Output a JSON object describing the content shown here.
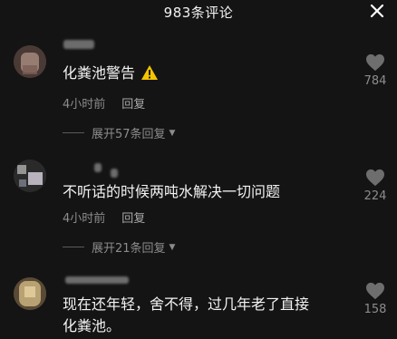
{
  "header": {
    "title": "983条评论",
    "close_icon": "close-icon"
  },
  "comments": [
    {
      "text": "化粪池警告",
      "has_warning_icon": true,
      "time": "4小时前",
      "reply_label": "回复",
      "expand_label": "展开57条回复",
      "likes": "784"
    },
    {
      "text": "不听话的时候两吨水解决一切问题",
      "time": "4小时前",
      "reply_label": "回复",
      "expand_label": "展开21条回复",
      "likes": "224"
    },
    {
      "text_line1": "现在还年轻，舍不得，过几年老了直接",
      "text_line2": "化粪池。",
      "likes": "158"
    }
  ],
  "colors": {
    "background": "#141414",
    "text": "#f3f3f3",
    "muted": "#8c8c8c",
    "warning": "#f5c400"
  }
}
